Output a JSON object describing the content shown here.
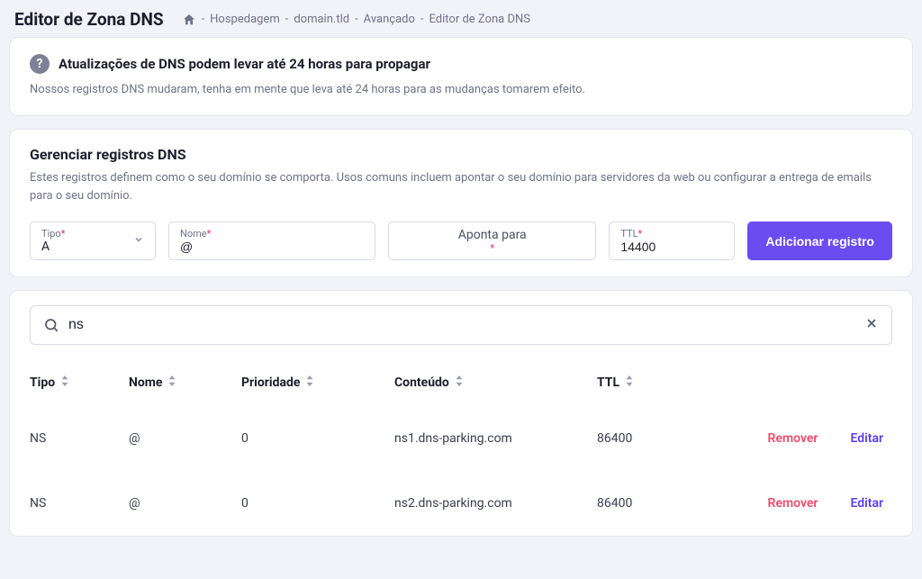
{
  "page_title": "Editor de Zona DNS",
  "breadcrumb": {
    "items": [
      "Hospedagem",
      "domain.tld",
      "Avançado",
      "Editor de Zona DNS"
    ]
  },
  "notice": {
    "title": "Atualizações de DNS podem levar até 24 horas para propagar",
    "desc": "Nossos registros DNS mudaram, tenha em mente que leva até 24 horas para as mudanças tomarem efeito."
  },
  "manage": {
    "title": "Gerenciar registros DNS",
    "desc": "Estes registros definem como o seu domínio se comporta. Usos comuns incluem apontar o seu domínio para servidores da web ou configurar a entrega de emails para o seu domínio."
  },
  "form": {
    "type_label": "Tipo",
    "type_value": "A",
    "name_label": "Nome",
    "name_value": "@",
    "points_placeholder": "Aponta para",
    "ttl_label": "TTL",
    "ttl_value": "14400",
    "submit": "Adicionar registro"
  },
  "search": {
    "value": "ns"
  },
  "columns": {
    "type": "Tipo",
    "name": "Nome",
    "priority": "Prioridade",
    "content": "Conteúdo",
    "ttl": "TTL"
  },
  "actions": {
    "remove": "Remover",
    "edit": "Editar"
  },
  "rows": [
    {
      "type": "NS",
      "name": "@",
      "priority": "0",
      "content": "ns1.dns-parking.com",
      "ttl": "86400"
    },
    {
      "type": "NS",
      "name": "@",
      "priority": "0",
      "content": "ns2.dns-parking.com",
      "ttl": "86400"
    }
  ]
}
